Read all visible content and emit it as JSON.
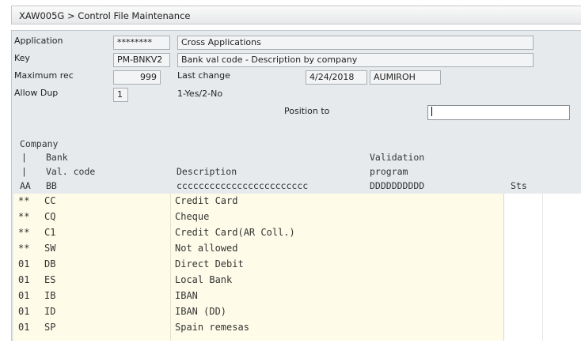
{
  "window": {
    "title": "XAW005G > Control File Maintenance"
  },
  "form": {
    "application": {
      "label": "Application",
      "code": "********",
      "description": "Cross Applications"
    },
    "key": {
      "label": "Key",
      "code": "PM-BNKV2",
      "description": "Bank val code - Description by company"
    },
    "max_rec": {
      "label": "Maximum rec",
      "value": "999"
    },
    "last_change": {
      "label": "Last change",
      "date": "4/24/2018",
      "user": "AUMIROH"
    },
    "allow_dup": {
      "label": "Allow Dup",
      "value": "1",
      "hint": "1-Yes/2-No"
    },
    "position_to": {
      "label": "Position to",
      "value": ""
    }
  },
  "grid_header": {
    "company": "Company",
    "bar1": "|",
    "bank": "Bank",
    "bar2": "|",
    "val_code": "Val. code",
    "aa": "AA",
    "bb": "BB",
    "description": "Description",
    "desc_pattern": "cccccccccccccccccccccccc",
    "validation": "Validation",
    "program": "program",
    "prog_pattern": "DDDDDDDDDD",
    "sts": "Sts"
  },
  "rows": [
    {
      "company": "**",
      "code": "CC",
      "description": "Credit Card"
    },
    {
      "company": "**",
      "code": "CQ",
      "description": "Cheque"
    },
    {
      "company": "**",
      "code": "C1",
      "description": "Credit Card(AR Coll.)"
    },
    {
      "company": "**",
      "code": "SW",
      "description": "Not allowed"
    },
    {
      "company": "01",
      "code": "DB",
      "description": "Direct Debit"
    },
    {
      "company": "01",
      "code": "ES",
      "description": "Local Bank"
    },
    {
      "company": "01",
      "code": "IB",
      "description": "IBAN"
    },
    {
      "company": "01",
      "code": "ID",
      "description": "IBAN (DD)"
    },
    {
      "company": "01",
      "code": "SP",
      "description": "Spain remesas"
    }
  ]
}
